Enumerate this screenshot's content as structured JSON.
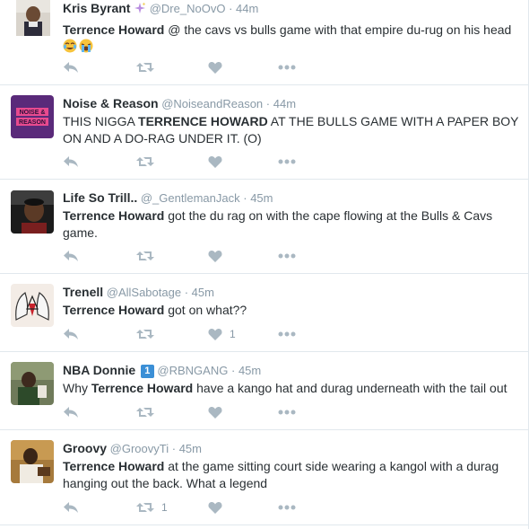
{
  "tweets": [
    {
      "name": "Kris Byrant",
      "badge_icon": "sparkles-icon",
      "handle": "@Dre_NoOvO",
      "time": "44m",
      "text_parts": [
        "Terrence Howard",
        " @ the cavs vs bulls game with that empire du-rug on his head "
      ],
      "emojis": [
        "face-with-tears-of-joy-icon",
        "loudly-crying-face-icon"
      ],
      "retweets": "",
      "likes": ""
    },
    {
      "name": "Noise & Reason",
      "handle": "@NoiseandReason",
      "time": "44m",
      "avatar_text": "NOISE & REASON",
      "text_parts": [
        "THIS NIGGA ",
        "TERRENCE HOWARD",
        " AT THE BULLS GAME WITH A PAPER BOY ON AND A DO-RAG UNDER IT. (O)"
      ],
      "retweets": "",
      "likes": ""
    },
    {
      "name": "Life So Trill..",
      "handle": "@_GentlemanJack",
      "time": "45m",
      "text_parts": [
        "Terrence Howard",
        " got the du rag on with the cape flowing at the Bulls & Cavs game."
      ],
      "retweets": "",
      "likes": ""
    },
    {
      "name": "Trenell",
      "handle": "@AllSabotage",
      "time": "45m",
      "text_parts": [
        "Terrence Howard",
        " got on what??"
      ],
      "retweets": "",
      "likes": "1"
    },
    {
      "name": "NBA Donnie",
      "badge_text": "1",
      "handle": "@RBNGANG",
      "time": "45m",
      "text_parts": [
        "Why ",
        "Terrence Howard",
        " have a kango hat and durag underneath with the tail out"
      ],
      "retweets": "",
      "likes": ""
    },
    {
      "name": "Groovy",
      "handle": "@GroovyTi",
      "time": "45m",
      "text_parts": [
        "Terrence Howard",
        " at the game sitting court side wearing a kangol with a durag hanging out the back. What a legend"
      ],
      "retweets": "1",
      "likes": ""
    }
  ],
  "separator": "·",
  "icons": {
    "reply": "reply-icon",
    "retweet": "retweet-icon",
    "like": "heart-icon",
    "more": "more-dots-icon"
  },
  "colors": {
    "text": "#292f33",
    "meta": "#8899a6",
    "action": "#aab8c2",
    "border": "#e1e8ed"
  }
}
